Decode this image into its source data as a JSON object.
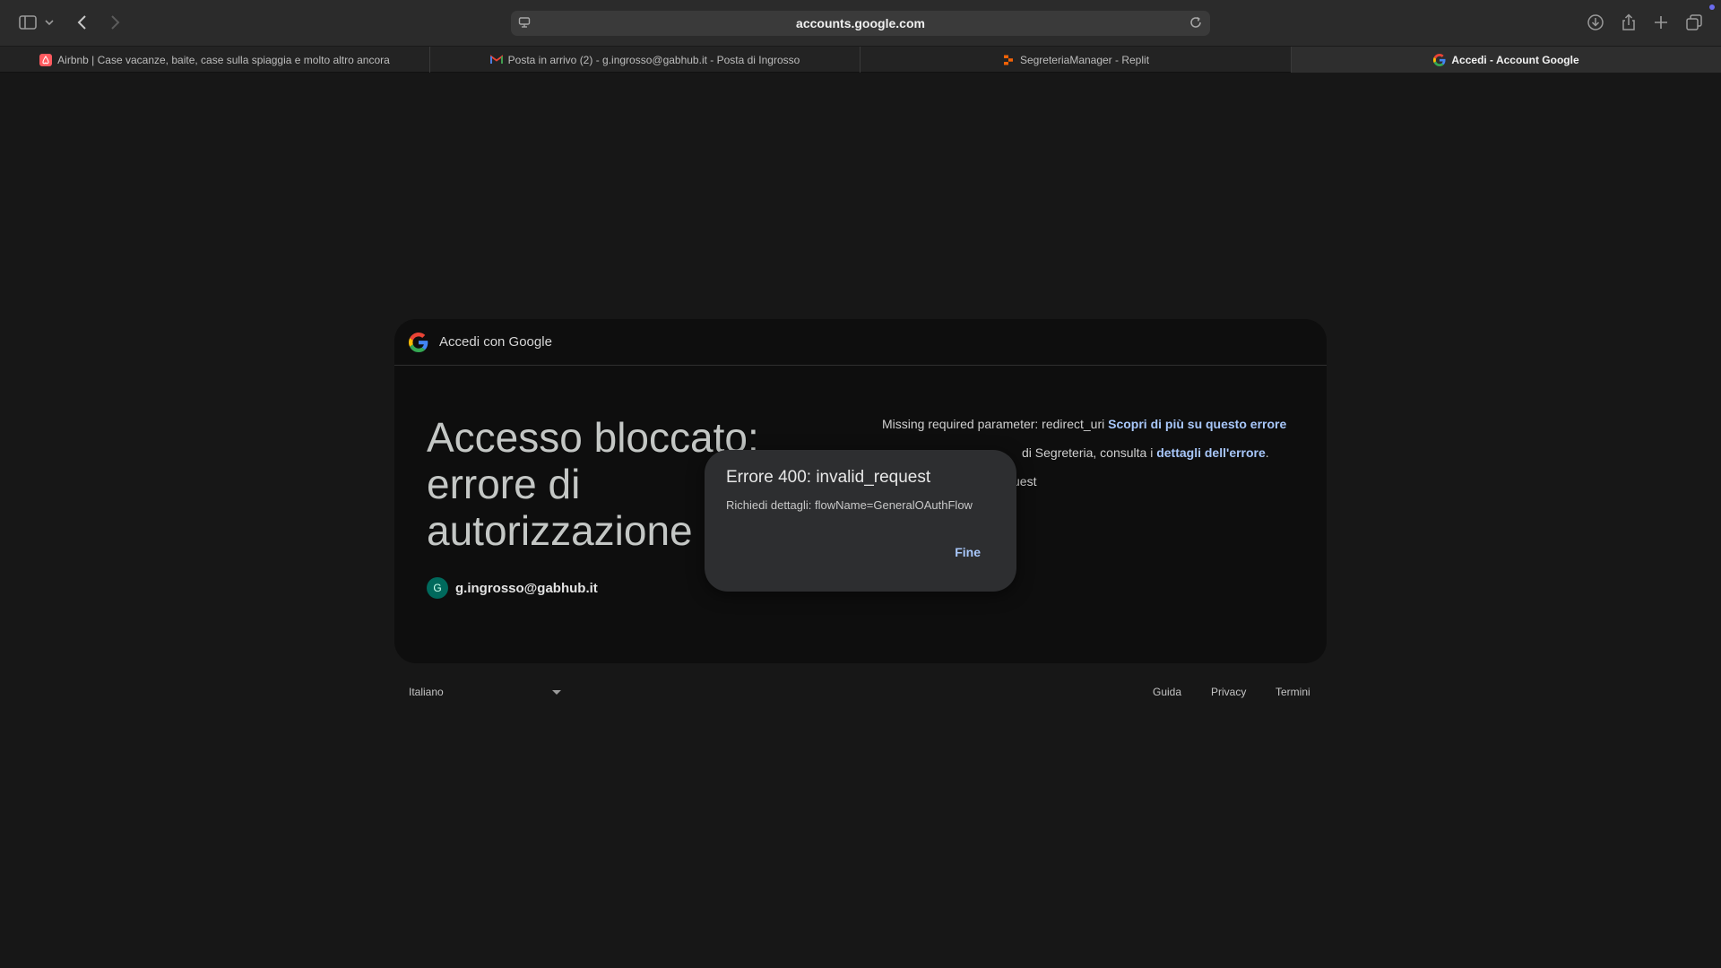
{
  "browser": {
    "url": "accounts.google.com",
    "tabs": [
      {
        "label": "Airbnb | Case vacanze, baite, case sulla spiaggia e molto altro ancora",
        "icon": "airbnb-icon"
      },
      {
        "label": "Posta in arrivo (2) - g.ingrosso@gabhub.it - Posta di Ingrosso",
        "icon": "gmail-icon"
      },
      {
        "label": "SegreteriaManager - Replit",
        "icon": "replit-icon"
      },
      {
        "label": "Accedi - Account Google",
        "icon": "google-icon",
        "active": true
      }
    ]
  },
  "page": {
    "header_title": "Accedi con Google",
    "big_title": "Accesso bloccato: errore di autorizzazione",
    "account_initial": "G",
    "account_email": "g.ingrosso@gabhub.it",
    "message_line1_text": "Missing required parameter: redirect_uri",
    "message_line1_link": "Scopri di più su questo errore",
    "message_line2_text": "di Segreteria, consulta i",
    "message_line2_link": "dettagli dell'errore",
    "message_line2_end": ".",
    "message_line3_text": "uest"
  },
  "footer": {
    "language": "Italiano",
    "links": [
      "Guida",
      "Privacy",
      "Termini"
    ]
  },
  "dialog": {
    "title": "Errore 400: invalid_request",
    "body": "Richiedi dettagli: flowName=GeneralOAuthFlow",
    "button": "Fine"
  },
  "colors": {
    "link": "#a8c7fa",
    "background": "#171717",
    "card": "#0e0e0e",
    "dialog": "#2d2e30",
    "avatar": "#00695c"
  }
}
